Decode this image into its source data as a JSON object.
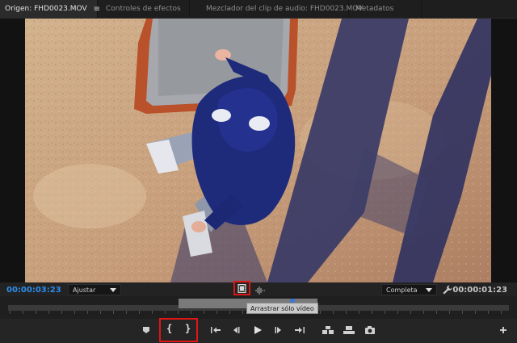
{
  "tabs": [
    {
      "label": "Origen: FHD0023.MOV",
      "active": true,
      "menu_glyph": "≡"
    },
    {
      "label": "Controles de efectos",
      "active": false
    },
    {
      "label": "Mezclador del clip de audio: FHD0023.MOV",
      "active": false
    },
    {
      "label": "Metadatos",
      "active": false
    }
  ],
  "monitor": {
    "timecode_current": "00:00:03:23",
    "timecode_duration": "00:00:01:23",
    "fit_dropdown": "Ajustar",
    "quality_dropdown": "Completa"
  },
  "tooltip": "Arrastrar sólo vídeo",
  "transport": {
    "mark_in": "{",
    "mark_out": "}"
  },
  "colors": {
    "timecode_blue": "#2d8ceb",
    "highlight_red": "#e01515",
    "panel_dark": "#232323"
  },
  "icons": [
    "menu-icon",
    "wrench-icon",
    "film-strip-icon",
    "audio-waveform-icon",
    "marker-icon",
    "go-to-in-icon",
    "step-back-icon",
    "play-icon",
    "step-forward-icon",
    "go-to-out-icon",
    "insert-icon",
    "overwrite-icon",
    "camera-icon",
    "add-icon"
  ]
}
